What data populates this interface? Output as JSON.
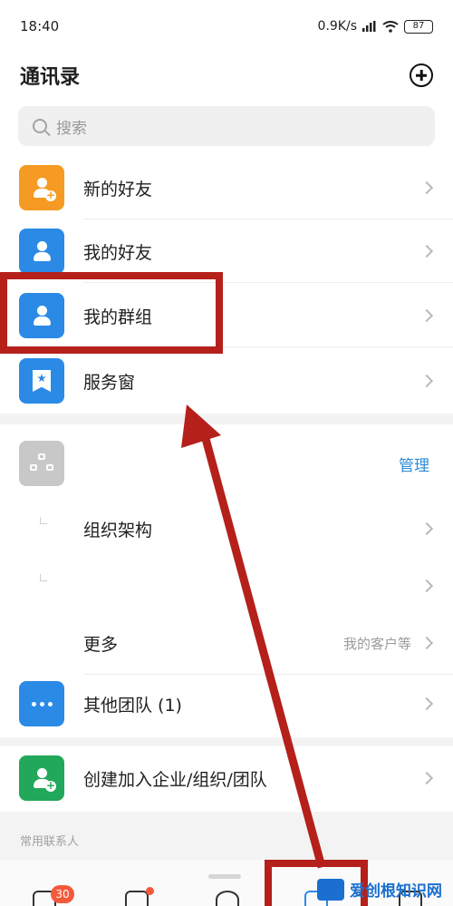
{
  "status_bar": {
    "time": "18:40",
    "speed": "0.9K/s",
    "battery": "87"
  },
  "header": {
    "title": "通讯录"
  },
  "search": {
    "placeholder": "搜索"
  },
  "rows": {
    "new_friends": "新的好友",
    "my_friends": "我的好友",
    "my_groups": "我的群组",
    "service_window": "服务窗",
    "manage": "管理",
    "org_structure": "组织架构",
    "more": "更多",
    "more_hint": "我的客户等",
    "other_teams": "其他团队 (1)",
    "create_join": "创建加入企业/组织/团队"
  },
  "section": {
    "frequent_contacts": "常用联系人"
  },
  "tab_bar": {
    "messages_badge": "30"
  },
  "watermark": {
    "text": "爱创根知识网"
  },
  "colors": {
    "orange": "#f59a23",
    "blue": "#2b8ae6",
    "gray": "#c8c8c8",
    "green": "#22a85a",
    "annotation_red": "#b5201a",
    "link_blue": "#2e8bd6"
  }
}
